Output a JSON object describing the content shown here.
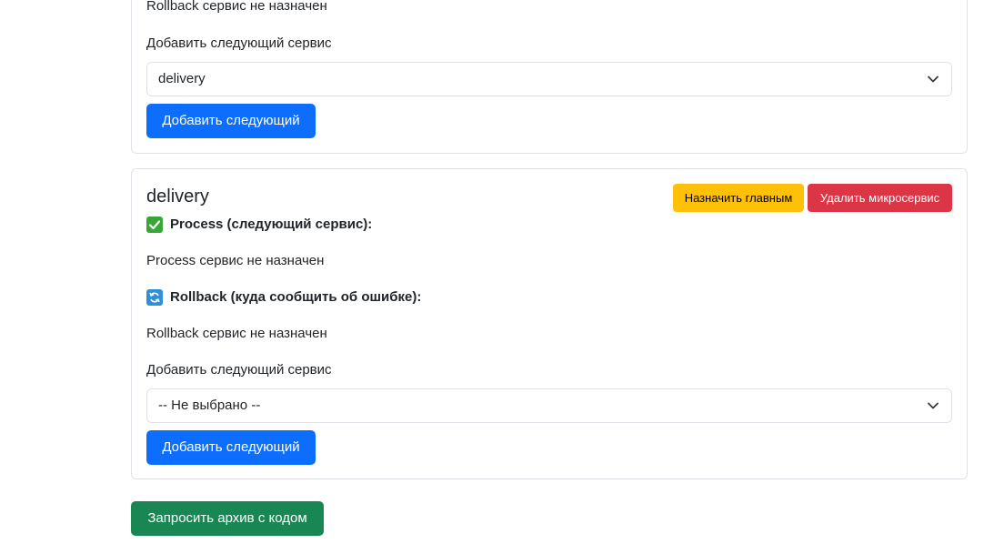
{
  "top_card": {
    "rollback_status": "Rollback сервис не назначен",
    "add_label": "Добавить следующий сервис",
    "select_value": "delivery",
    "add_button": "Добавить следующий"
  },
  "delivery_card": {
    "title": "delivery",
    "set_main_button": "Назначить главным",
    "delete_button": "Удалить микросервис",
    "process_heading": "Process (следующий сервис):",
    "process_status": "Process сервис не назначен",
    "rollback_heading": "Rollback (куда сообщить об ошибке):",
    "rollback_status": "Rollback сервис не назначен",
    "add_label": "Добавить следующий сервис",
    "select_value": "-- Не выбрано --",
    "add_button": "Добавить следующий"
  },
  "request_archive_button": "Запросить архив с кодом",
  "icons": {
    "process": "check-mark-icon",
    "rollback": "refresh-icon",
    "select": "chevron-down-icon"
  }
}
